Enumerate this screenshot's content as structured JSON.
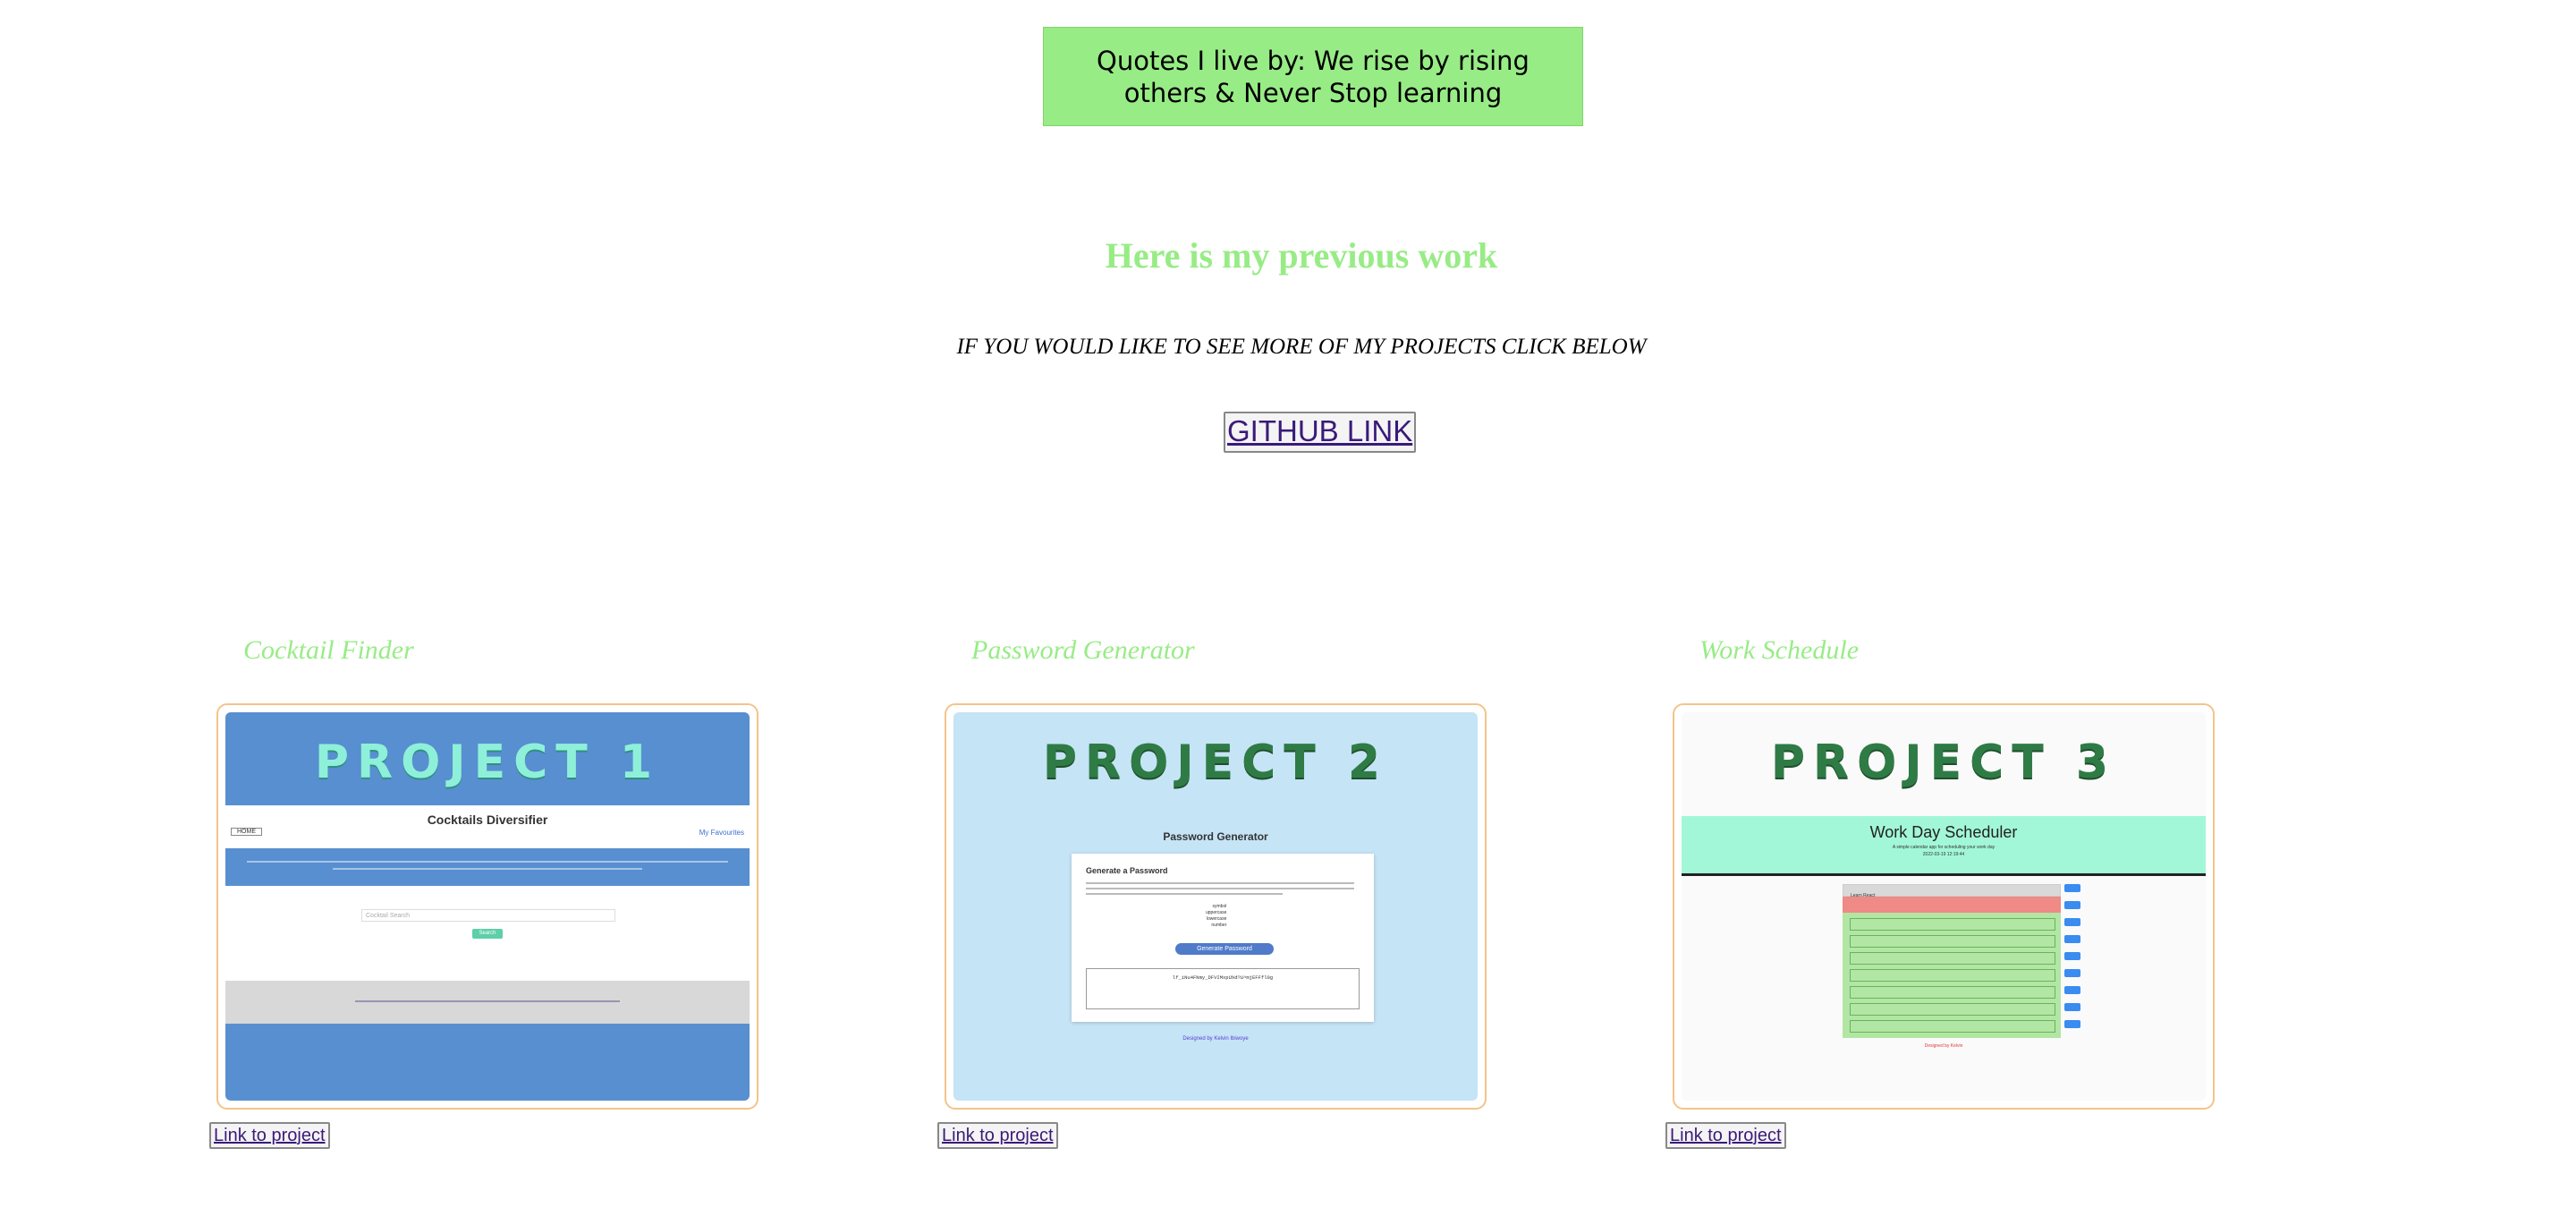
{
  "quote": "Quotes I live by: We rise by rising others & Never Stop learning",
  "section_title": "Here is my previous work",
  "more_text": "IF YOU WOULD LIKE TO SEE MORE OF MY PROJECTS CLICK BELOW",
  "github_link": "GITHUB LINK",
  "projects": [
    {
      "title": "Cocktail Finder",
      "label": "PROJECT 1",
      "link": "Link to project",
      "shot": {
        "heading": "Cocktails Diversifier",
        "home": "HOME",
        "favourites": "My Favourites",
        "search_placeholder": "Cocktail Search",
        "search_button": "Search"
      }
    },
    {
      "title": "Password Generator",
      "label": "PROJECT 2",
      "link": "Link to project",
      "shot": {
        "heading": "Password Generator",
        "card_title": "Generate a Password",
        "options": [
          "symbol",
          "uppercase",
          "lowercase",
          "number"
        ],
        "button": "Generate Password",
        "password": "lf_iNu4FNmy_DFVIMxpU%d?U^mjEFFfl0g",
        "footer": "Designed by Kelvin Ibiwoye"
      }
    },
    {
      "title": "Work Schedule",
      "label": "PROJECT 3",
      "link": "Link to project",
      "shot": {
        "heading": "Work Day Scheduler",
        "subheading": "A simple calendar app for scheduling your work day",
        "date": "2022-03-19 12:19:44",
        "first_task": "Learn React",
        "footer": "Designed by Kelvin"
      }
    }
  ],
  "colors": {
    "accent_green": "#98ec86",
    "card_border": "#f3c48a",
    "project1_blue": "#588fd0",
    "project2_bg": "#c5e4f6",
    "project3_header": "#a2f7d8"
  }
}
